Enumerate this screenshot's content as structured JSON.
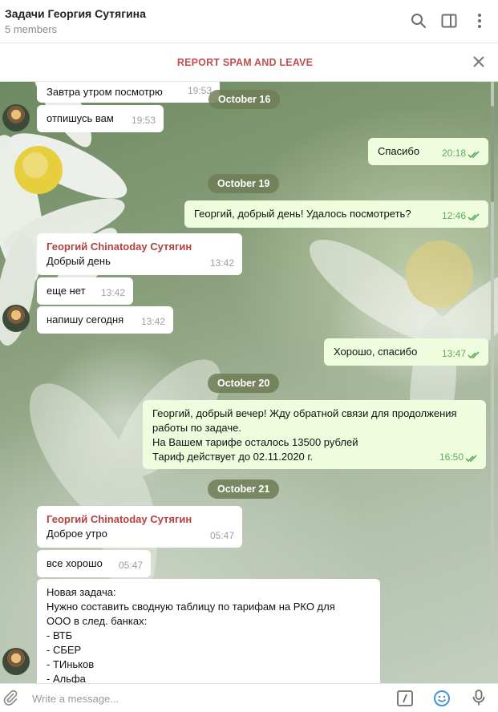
{
  "header": {
    "title": "Задачи Георгия Сутягина",
    "subtitle": "5 members"
  },
  "spam_bar": {
    "label": "REPORT SPAM AND LEAVE"
  },
  "messages": {
    "m0": {
      "text": "Завтра утром посмотрю",
      "time": "19:53"
    },
    "d1": "October 16",
    "m1": {
      "text": "отпишусь вам",
      "time": "19:53"
    },
    "m2": {
      "text": "Спасибо",
      "time": "20:18"
    },
    "d2": "October 19",
    "m3": {
      "text": "Георгий, добрый день! Удалось посмотреть?",
      "time": "12:46"
    },
    "m4": {
      "sender": "Георгий Chinatoday Сутягин",
      "text": "Добрый день",
      "time": "13:42"
    },
    "m5": {
      "text": "еще нет",
      "time": "13:42"
    },
    "m6": {
      "text": "напишу сегодня",
      "time": "13:42"
    },
    "m7": {
      "text": "Хорошо, спасибо",
      "time": "13:47"
    },
    "d3": "October 20",
    "m8": {
      "line1": "Георгий, добрый вечер! Жду обратной связи для продолжения",
      "line2": "работы по задаче.",
      "line3": "На Вашем тарифе осталось 13500 рублей",
      "line4": "Тариф действует до 02.11.2020 г.",
      "time": "16:50"
    },
    "d4": "October 21",
    "m9": {
      "sender": "Георгий Chinatoday Сутягин",
      "text": "Доброе утро",
      "time": "05:47"
    },
    "m10": {
      "text": "все хорошо",
      "time": "05:47"
    },
    "m11": {
      "line1": "Новая задача:",
      "line2": "Нужно составить сводную таблицу по тарифам на РКО для",
      "line3": "ООО в след. банках:",
      "line4": "- ВТБ",
      "line5": "- СБЕР",
      "line6": "- ТИньков",
      "line7": "- Альфа"
    }
  },
  "composer": {
    "placeholder": "Write a message..."
  },
  "icons": {
    "search": "search-icon",
    "sidebar": "sidebar-toggle-icon",
    "menu": "more-vertical-icon",
    "close": "close-icon",
    "attach": "paperclip-icon",
    "commands": "slash-command-icon",
    "emoji": "emoji-icon",
    "mic": "microphone-icon",
    "read": "double-check-icon"
  },
  "colors": {
    "accent": "#c0504d",
    "outgoing_bubble": "#effdde",
    "read_check": "#5cae5d",
    "emoji_icon": "#4a90d9"
  }
}
